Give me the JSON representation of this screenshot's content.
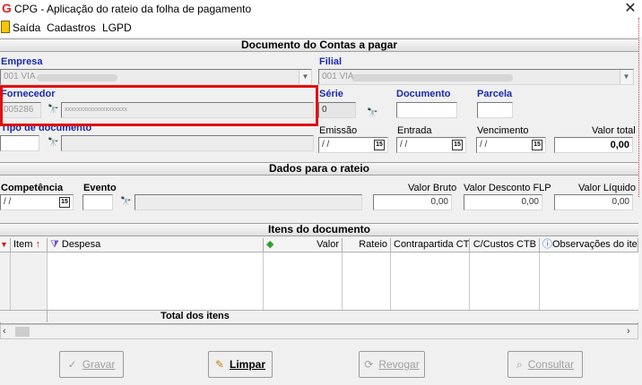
{
  "window": {
    "title": "CPG - Aplicação do rateio da folha de pagamento",
    "close": "✕"
  },
  "menu": {
    "items": [
      "Saída",
      "Cadastros",
      "LGPD"
    ]
  },
  "documento": {
    "header": "Documento do Contas a pagar",
    "empresa_label": "Empresa",
    "empresa_value": "001 VIA",
    "filial_label": "Filial",
    "filial_value": "001 VIA",
    "fornecedor_label": "Fornecedor",
    "fornecedor_code": "005286",
    "fornecedor_name": "xxxxxxxxxxxxxxxxxxxx",
    "serie_label": "Série",
    "serie_value": "0",
    "documento_label": "Documento",
    "parcela_label": "Parcela",
    "tipo_label": "Tipo de documento",
    "emissao_label": "Emissão",
    "emissao_value": "/ /",
    "entrada_label": "Entrada",
    "entrada_value": "/ /",
    "vencimento_label": "Vencimento",
    "vencimento_value": "/ /",
    "valor_total_label": "Valor total",
    "valor_total_value": "0,00"
  },
  "rateio": {
    "header": "Dados para o rateio",
    "competencia_label": "Competência",
    "competencia_value": "/ /",
    "evento_label": "Evento",
    "valor_bruto_label": "Valor Bruto",
    "valor_bruto_value": "0,00",
    "valor_desconto_label": "Valor Desconto FLP",
    "valor_desconto_value": "0,00",
    "valor_liquido_label": "Valor Líquido",
    "valor_liquido_value": "0,00"
  },
  "itens": {
    "header": "Itens do documento",
    "columns": [
      "Item",
      "Despesa",
      "Valor",
      "Rateio",
      "Contrapartida CTB",
      "C/Custos CTB",
      "Observações do iter"
    ],
    "total_label": "Total dos itens"
  },
  "buttons": {
    "gravar": "Gravar",
    "limpar": "Limpar",
    "revogar": "Revogar",
    "consultar": "Consultar"
  },
  "icons": {
    "calendar": "15",
    "binoculars": "👓"
  }
}
